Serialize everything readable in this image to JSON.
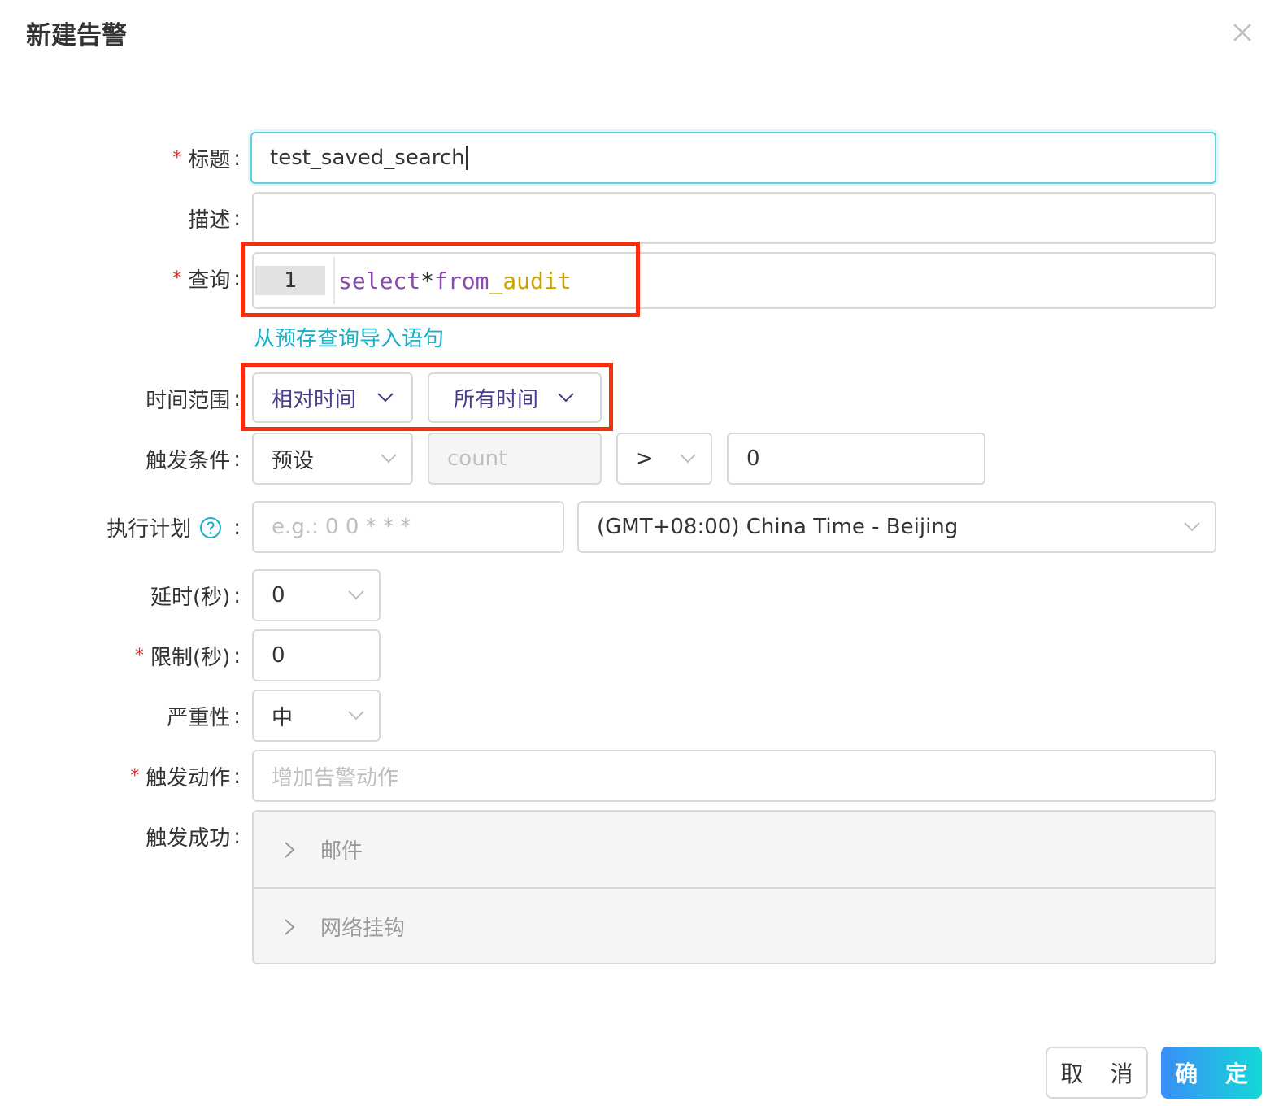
{
  "dialog": {
    "title": "新建告警",
    "close_icon": "close-icon"
  },
  "form": {
    "title": {
      "label": "标题",
      "required": "*",
      "value": "test_saved_search"
    },
    "description": {
      "label": "描述",
      "value": ""
    },
    "query": {
      "label": "查询",
      "required": "*",
      "line_number": "1",
      "code": {
        "kw1": "select",
        "op": "*",
        "kw2": "from",
        "table": "_audit"
      },
      "import_link": "从预存查询导入语句"
    },
    "time_range": {
      "label": "时间范围",
      "type_value": "相对时间",
      "range_value": "所有时间"
    },
    "trigger_condition": {
      "label": "触发条件",
      "mode_value": "预设",
      "field_value": "count",
      "operator_value": ">",
      "threshold_value": "0"
    },
    "schedule": {
      "label": "执行计划",
      "help_icon": "question-circle-icon",
      "cron_placeholder": "e.g.: 0 0 * * *",
      "timezone_value": "(GMT+08:00) China Time - Beijing"
    },
    "delay": {
      "label": "延时(秒)",
      "value": "0"
    },
    "limit": {
      "label": "限制(秒)",
      "required": "*",
      "value": "0"
    },
    "severity": {
      "label": "严重性",
      "value": "中"
    },
    "trigger_action": {
      "label": "触发动作",
      "required": "*",
      "placeholder": "增加告警动作"
    },
    "trigger_success": {
      "label": "触发成功",
      "items": [
        "邮件",
        "网络挂钩"
      ]
    }
  },
  "footer": {
    "cancel_label": "取 消",
    "ok_label": "确 定"
  },
  "colors": {
    "accent": "#1ab0c9",
    "required": "#f5222d",
    "highlight_box": "#ff2a0a",
    "primary_gradient_start": "#3a8ef6",
    "primary_gradient_end": "#14d8d8"
  }
}
